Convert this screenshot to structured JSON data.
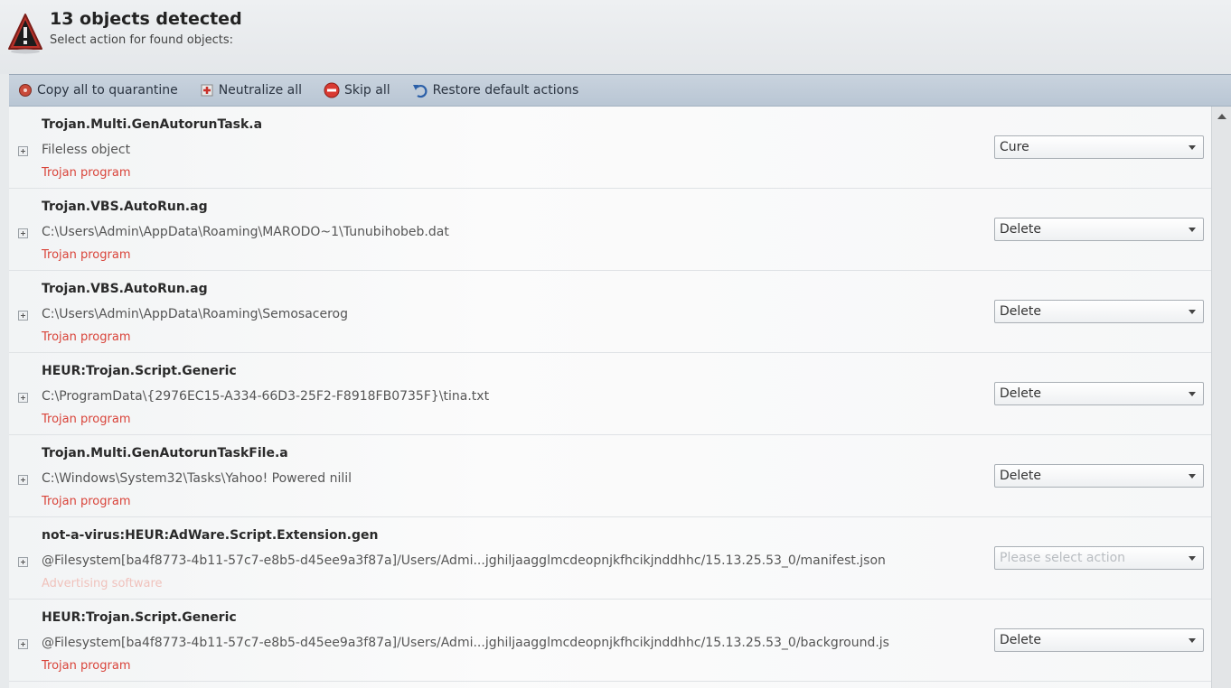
{
  "header": {
    "title": "13 objects detected",
    "subtitle": "Select action for found objects:"
  },
  "toolbar": {
    "copy_quarantine": "Copy all to quarantine",
    "neutralize_all": "Neutralize all",
    "skip_all": "Skip all",
    "restore_defaults": "Restore default actions"
  },
  "items": [
    {
      "name": "Trojan.Multi.GenAutorunTask.a",
      "path": "Fileless object",
      "type": "Trojan program",
      "action": "Cure"
    },
    {
      "name": "Trojan.VBS.AutoRun.ag",
      "path": "C:\\Users\\Admin\\AppData\\Roaming\\MARODO~1\\Tunubihobeb.dat",
      "type": "Trojan program",
      "action": "Delete"
    },
    {
      "name": "Trojan.VBS.AutoRun.ag",
      "path": "C:\\Users\\Admin\\AppData\\Roaming\\Semosacerog",
      "type": "Trojan program",
      "action": "Delete"
    },
    {
      "name": "HEUR:Trojan.Script.Generic",
      "path": "C:\\ProgramData\\{2976EC15-A334-66D3-25F2-F8918FB0735F}\\tina.txt",
      "type": "Trojan program",
      "action": "Delete"
    },
    {
      "name": "Trojan.Multi.GenAutorunTaskFile.a",
      "path": "C:\\Windows\\System32\\Tasks\\Yahoo! Powered nilil",
      "type": "Trojan program",
      "action": "Delete"
    },
    {
      "name": "not-a-virus:HEUR:AdWare.Script.Extension.gen",
      "path": "@Filesystem[ba4f8773-4b11-57c7-e8b5-d45ee9a3f87a]/Users/Admi...jghiljaagglmcdeopnjkfhcikjnddhhc/15.13.25.53_0/manifest.json",
      "type": "Advertising software",
      "action": "Please select action"
    },
    {
      "name": "HEUR:Trojan.Script.Generic",
      "path": "@Filesystem[ba4f8773-4b11-57c7-e8b5-d45ee9a3f87a]/Users/Admi...jghiljaagglmcdeopnjkfhcikjnddhhc/15.13.25.53_0/background.js",
      "type": "Trojan program",
      "action": "Delete"
    }
  ]
}
